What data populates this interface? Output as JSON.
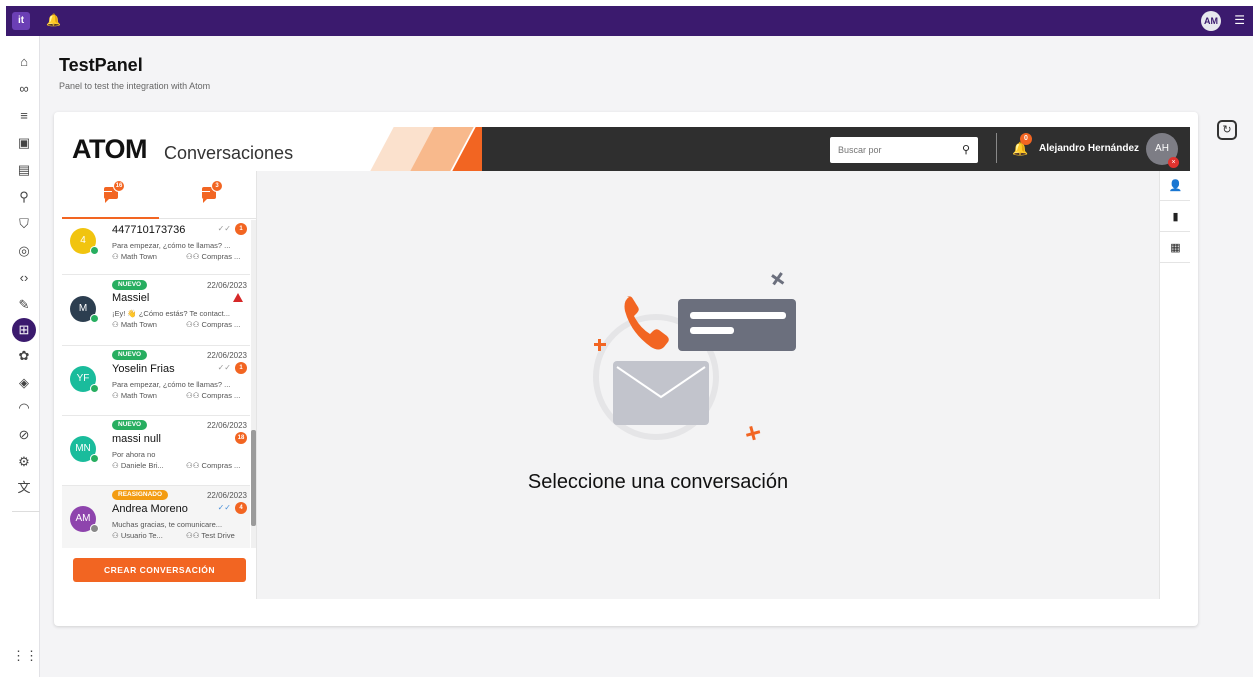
{
  "topbar": {
    "logo": "it",
    "user_initials": "AM"
  },
  "rail": {
    "icons": [
      "home-icon",
      "voicemail-icon",
      "list-icon",
      "contact-icon",
      "book-icon",
      "flow-icon",
      "shield-icon",
      "fingerprint-icon",
      "code-icon",
      "edit-icon",
      "apps-icon",
      "brain-icon",
      "cpu-icon",
      "speed-icon",
      "compass-icon",
      "settings-icon",
      "translate-icon",
      "grid-icon"
    ]
  },
  "page": {
    "title": "TestPanel",
    "subtitle": "Panel to test the integration with Atom"
  },
  "atom": {
    "logo": "ATOM",
    "logo_sub": "Conversaciones",
    "search_placeholder": "Buscar por",
    "notifications": "0",
    "user_name": "Alejandro Hernández",
    "user_initials": "AH",
    "tabs": [
      {
        "badge": "16"
      },
      {
        "badge": "3"
      }
    ],
    "conversations": [
      {
        "avatar": "4",
        "avatar_color": "#f1c40f",
        "tag": "",
        "date": "",
        "name": "447710173736",
        "status": "read",
        "count": "1",
        "preview": "Para empezar, ¿cómo te llamas? ...",
        "owner": "Math Town",
        "team": "Compras ..."
      },
      {
        "avatar": "M",
        "avatar_color": "#2c3e50",
        "tag": "NUEVO",
        "tag_color": "#27ae60",
        "date": "22/06/2023",
        "name": "Massiel",
        "status": "warn",
        "count": "",
        "preview": "¡Ey! 👋 ¿Cómo estás? Te contact...",
        "owner": "Math Town",
        "team": "Compras ..."
      },
      {
        "avatar": "YF",
        "avatar_color": "#1abc9c",
        "tag": "NUEVO",
        "tag_color": "#27ae60",
        "date": "22/06/2023",
        "name": "Yoselin Frias",
        "status": "sent",
        "count": "1",
        "preview": "Para empezar, ¿cómo te llamas? ...",
        "owner": "Math Town",
        "team": "Compras ..."
      },
      {
        "avatar": "MN",
        "avatar_color": "#1abc9c",
        "tag": "NUEVO",
        "tag_color": "#27ae60",
        "date": "22/06/2023",
        "name": "massi null",
        "status": "none",
        "count": "18",
        "preview": "Por ahora no",
        "owner": "Daniele Bri...",
        "team": "Compras ..."
      },
      {
        "avatar": "AM",
        "avatar_color": "#8e44ad",
        "tag": "REASIGNADO",
        "tag_color": "#f39c12",
        "date": "22/06/2023",
        "name": "Andrea Moreno",
        "status": "read",
        "count": "4",
        "preview": "Muchas gracias, te comunicare...",
        "owner": "Usuario Te...",
        "team": "Test Drive"
      }
    ],
    "create_button": "CREAR CONVERSACIÓN",
    "empty_message": "Seleccione una conversación",
    "side_tools": [
      "person-icon",
      "document-icon",
      "calendar-icon"
    ],
    "accent": "#f26522"
  }
}
